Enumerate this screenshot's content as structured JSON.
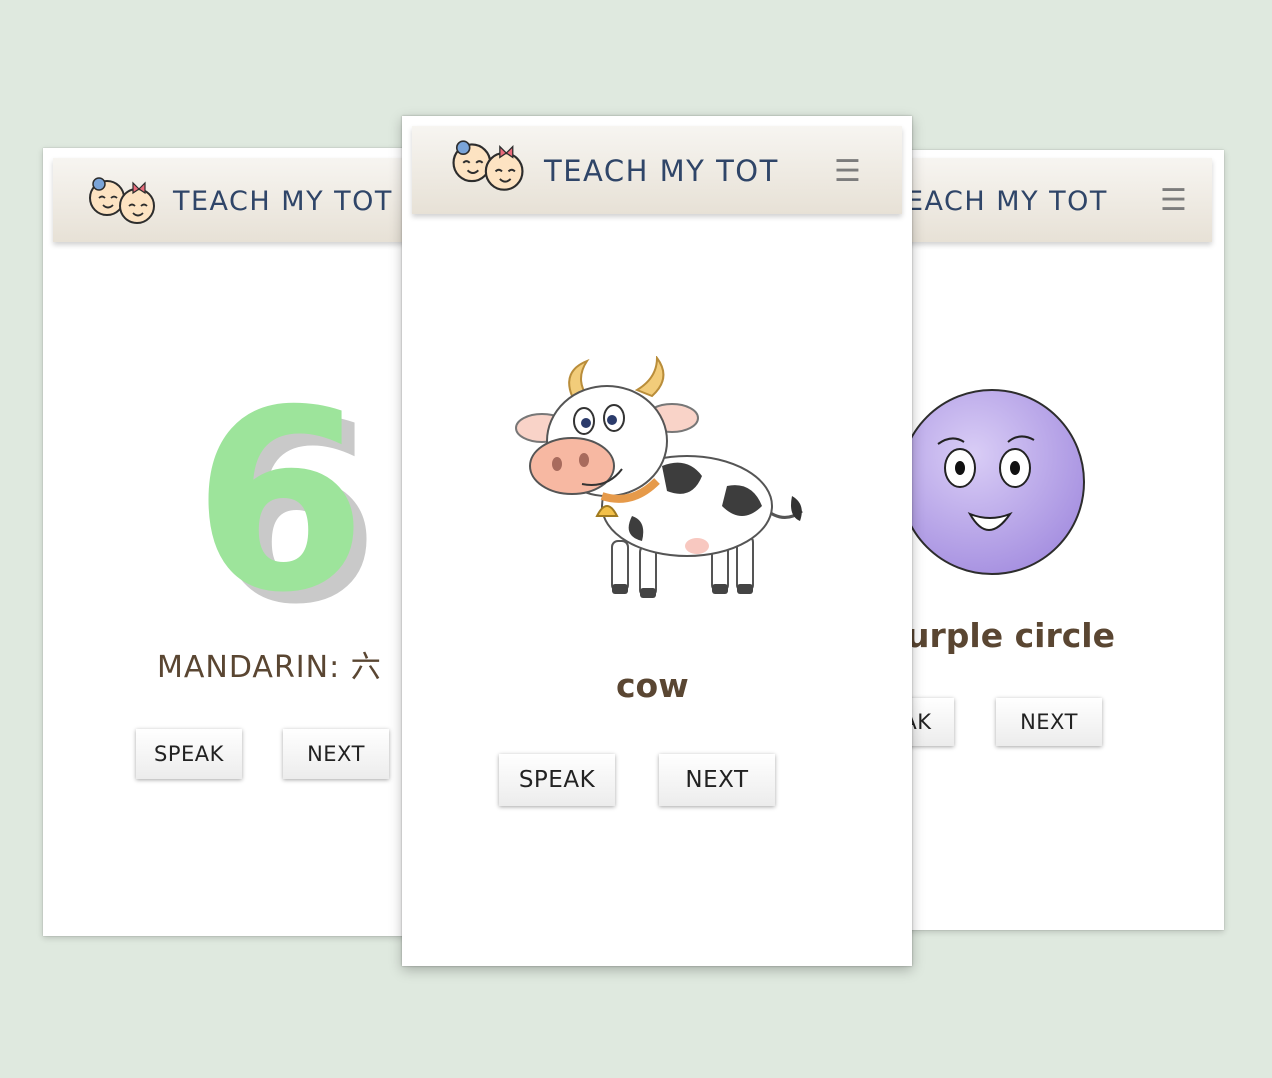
{
  "brand": {
    "name": "TEACH MY TOT"
  },
  "cards": {
    "left": {
      "number": "6",
      "label": "MANDARIN: 六",
      "speak_label": "SPEAK",
      "next_label": "NEXT"
    },
    "center": {
      "label": "cow",
      "speak_label": "SPEAK",
      "next_label": "NEXT"
    },
    "right": {
      "brand_visible": "EACH MY TOT",
      "label": "urple circle",
      "speak_label": "AK",
      "next_label": "NEXT"
    }
  },
  "icons": {
    "logo": "baby-faces-icon",
    "menu": "hamburger-menu-icon"
  },
  "colors": {
    "background": "#dfe9df",
    "brand_text": "#2f4568",
    "label_text": "#5a4632",
    "number_fill": "#9de49b",
    "circle_fill": "#b8a6e8"
  },
  "glyphs": {
    "menu": "☰"
  }
}
